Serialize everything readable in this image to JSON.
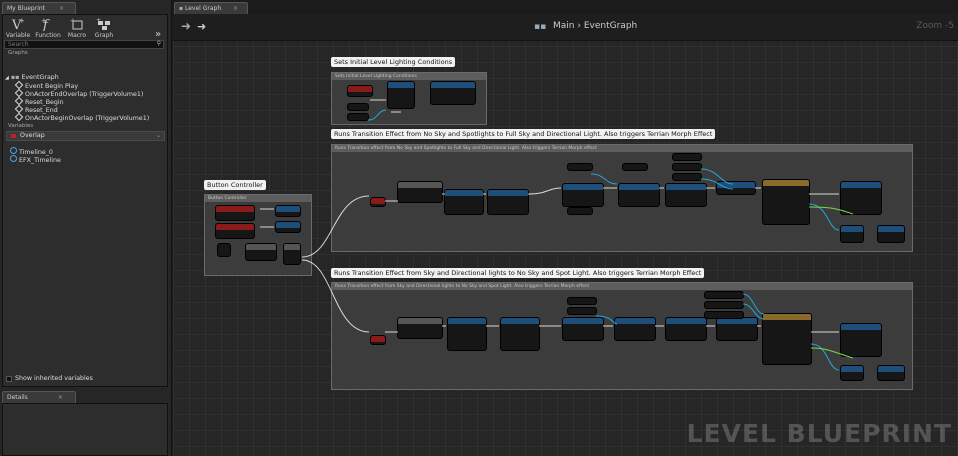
{
  "my_blueprint": {
    "tab_label": "My Blueprint",
    "tools": [
      {
        "label": "Variable",
        "icon": "variable-icon"
      },
      {
        "label": "Function",
        "icon": "function-icon"
      },
      {
        "label": "Macro",
        "icon": "macro-icon"
      },
      {
        "label": "Graph",
        "icon": "graph-icon"
      }
    ],
    "search_placeholder": "Search",
    "graphs_header": "Graphs",
    "event_graph": "EventGraph",
    "events": [
      "Event Begin Play",
      "OnActorEndOverlap (TriggerVolume1)",
      "Reset_Begin",
      "Reset_End",
      "OnActorBeginOverlap (TriggerVolume1)"
    ],
    "variables_header": "Variables",
    "category": "Overlap",
    "variables": [
      "Timeline_0",
      "EFX_Timeline"
    ],
    "show_inherited": "Show inherited variables"
  },
  "details": {
    "tab_label": "Details"
  },
  "graph": {
    "tab_label": "Level Graph",
    "breadcrumb_root": "Main",
    "breadcrumb_current": "EventGraph",
    "zoom": "Zoom -5",
    "watermark": "LEVEL BLUEPRINT"
  },
  "comments": [
    {
      "title": "Sets Initial Level Lighting Conditions",
      "header": "Sets Initial Level Lighting Conditions"
    },
    {
      "title": "Runs Transition Effect from No Sky and Spotlights to Full Sky and Directional Light.  Also triggers Terrian Morph Effect",
      "header": "Runs Transition effect from No Sky and Spotlights to Full Sky and Directional Light. Also triggers Terrian Morph effect"
    },
    {
      "title": "Button Controller",
      "header": "Button Controller"
    },
    {
      "title": "Runs Transition Effect from Sky and Directional lights to No Sky and Spot Light.  Also triggers Terrian Morph Effect",
      "header": "Runs Transition effect from Sky and Directional lights to No Sky and Spot Light. Also triggers Terrian Morph effect"
    }
  ],
  "colors": {
    "event": "#8b1a1a",
    "function": "#1e4f7a",
    "exec": "#ffffff",
    "object_pin": "#27a7d8",
    "float_pin": "#7bd84a",
    "bool_pin": "#aa1d1d"
  }
}
